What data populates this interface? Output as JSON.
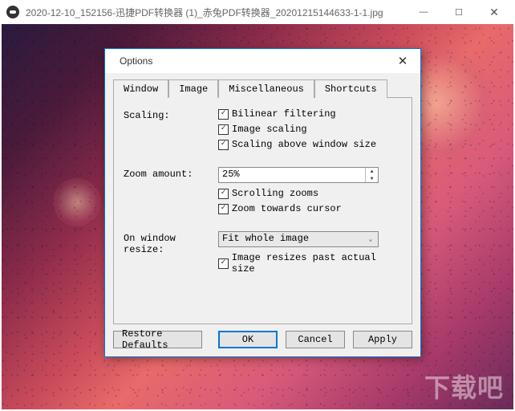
{
  "main_window": {
    "title": "2020-12-10_152156-迅捷PDF转换器 (1)_赤兔PDF转换器_20201215144633-1-1.jpg"
  },
  "watermark": "下载吧",
  "dialog": {
    "title": "Options",
    "tabs": {
      "window": "Window",
      "image": "Image",
      "misc": "Miscellaneous",
      "shortcuts": "Shortcuts"
    },
    "scaling": {
      "label": "Scaling:",
      "bilinear": "Bilinear filtering",
      "image_scaling": "Image scaling",
      "above_window": "Scaling above window size"
    },
    "zoom": {
      "label": "Zoom amount:",
      "value": "25%",
      "scroll_zooms": "Scrolling zooms",
      "towards_cursor": "Zoom towards cursor"
    },
    "resize": {
      "label": "On window resize:",
      "value": "Fit whole image",
      "past_actual": "Image resizes past actual size"
    },
    "buttons": {
      "restore": "Restore Defaults",
      "ok": "OK",
      "cancel": "Cancel",
      "apply": "Apply"
    }
  }
}
